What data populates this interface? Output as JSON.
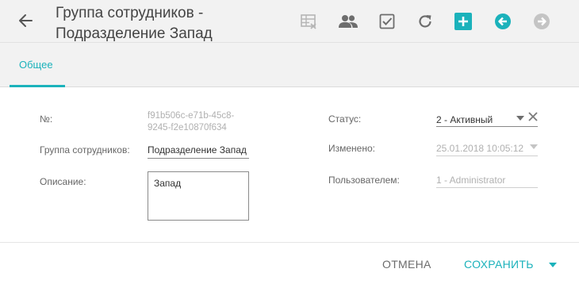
{
  "header": {
    "title_line1": "Группа сотрудников -",
    "title_line2": "Подразделение Запад",
    "accent_color": "#1bb2bb"
  },
  "toolbar": {
    "icons": [
      "grid-delete-icon",
      "users-icon",
      "checkbox-icon",
      "refresh-icon",
      "add-icon",
      "previous-icon",
      "next-icon"
    ]
  },
  "tabs": [
    {
      "label": "Общее",
      "active": true
    }
  ],
  "form": {
    "number": {
      "label": "№:",
      "value": "f91b506c-e71b-45c8-9245-f2e10870f634",
      "value_line1": "f91b506c-e71b-45c8-",
      "value_line2": "9245-f2e10870f634"
    },
    "group": {
      "label": "Группа сотрудников:",
      "value": "Подразделение Запад"
    },
    "description": {
      "label": "Описание:",
      "value": "Запад"
    },
    "status": {
      "label": "Статус:",
      "value": "2 - Активный"
    },
    "modified": {
      "label": "Изменено:",
      "value": "25.01.2018 10:05:12"
    },
    "user": {
      "label": "Пользователем:",
      "value": "1 - Administrator"
    }
  },
  "footer": {
    "cancel_label": "ОТМЕНА",
    "save_label": "СОХРАНИТЬ"
  }
}
